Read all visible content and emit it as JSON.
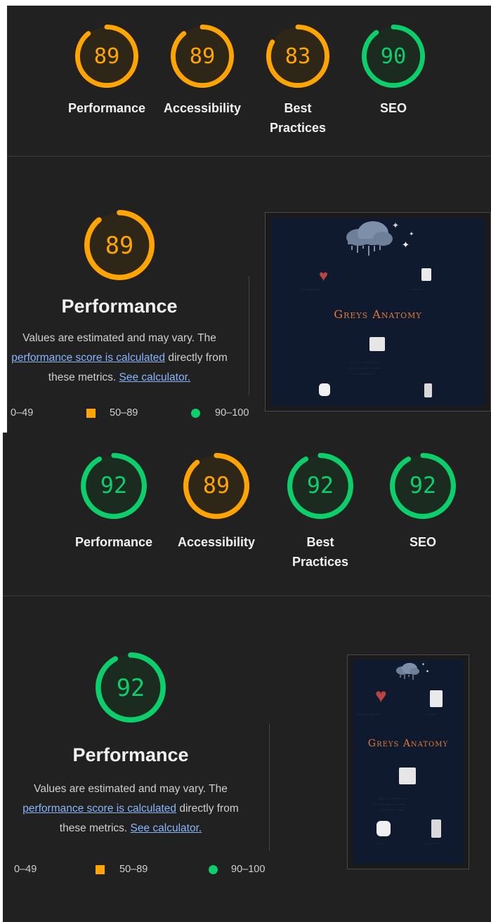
{
  "colors": {
    "orange": "#ffa400",
    "green": "#0cce6b",
    "link": "#8ab4f8",
    "panel": "#212121"
  },
  "report1": {
    "gauges": [
      {
        "score": 89,
        "label": "Performance",
        "color": "orange"
      },
      {
        "score": 89,
        "label": "Accessibility",
        "color": "orange"
      },
      {
        "score": 83,
        "label": "Best Practices",
        "color": "orange"
      },
      {
        "score": 90,
        "label": "SEO",
        "color": "green"
      }
    ],
    "performance": {
      "score": 89,
      "title": "Performance",
      "desc_line1": "Values are estimated and may vary. The",
      "desc_link1": "performance score is calculated",
      "desc_mid": " directly from",
      "desc_line3": "these metrics. ",
      "desc_link2": "See calculator.",
      "legend": [
        "0–49",
        "50–89",
        "90–100"
      ]
    },
    "screenshot": {
      "title": "Greys Anatomy"
    }
  },
  "report2": {
    "gauges": [
      {
        "score": 92,
        "label": "Performance",
        "color": "green"
      },
      {
        "score": 89,
        "label": "Accessibility",
        "color": "orange"
      },
      {
        "score": 92,
        "label": "Best Practices",
        "color": "green"
      },
      {
        "score": 92,
        "label": "SEO",
        "color": "green"
      }
    ],
    "performance": {
      "score": 92,
      "title": "Performance",
      "desc_line1": "Values are estimated and may vary. The",
      "desc_link1": "performance score is calculated",
      "desc_mid": " directly from",
      "desc_line3": "these metrics. ",
      "desc_link2": "See calculator.",
      "legend": [
        "0–49",
        "50–89",
        "90–100"
      ]
    },
    "screenshot": {
      "title": "Greys Anatomy"
    }
  }
}
